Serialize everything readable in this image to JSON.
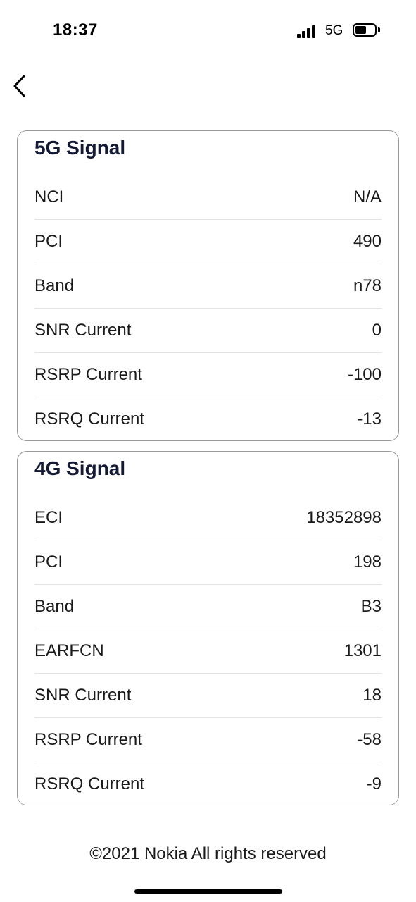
{
  "status_bar": {
    "time": "18:37",
    "network": "5G",
    "signal_icon": "cellular-signal-icon",
    "battery_icon": "battery-icon"
  },
  "nav": {
    "back_icon": "chevron-left-icon"
  },
  "signal_5g": {
    "title": "5G Signal",
    "rows": [
      {
        "label": "NCI",
        "value": "N/A"
      },
      {
        "label": "PCI",
        "value": "490"
      },
      {
        "label": "Band",
        "value": "n78"
      },
      {
        "label": "SNR Current",
        "value": "0"
      },
      {
        "label": "RSRP Current",
        "value": "-100"
      },
      {
        "label": "RSRQ Current",
        "value": "-13"
      }
    ]
  },
  "signal_4g": {
    "title": "4G Signal",
    "rows": [
      {
        "label": "ECI",
        "value": "18352898"
      },
      {
        "label": "PCI",
        "value": "198"
      },
      {
        "label": "Band",
        "value": "B3"
      },
      {
        "label": "EARFCN",
        "value": "1301"
      },
      {
        "label": "SNR Current",
        "value": "18"
      },
      {
        "label": "RSRP Current",
        "value": "-58"
      },
      {
        "label": "RSRQ Current",
        "value": "-9"
      }
    ]
  },
  "footer": {
    "copyright": "©2021 Nokia All rights reserved"
  }
}
